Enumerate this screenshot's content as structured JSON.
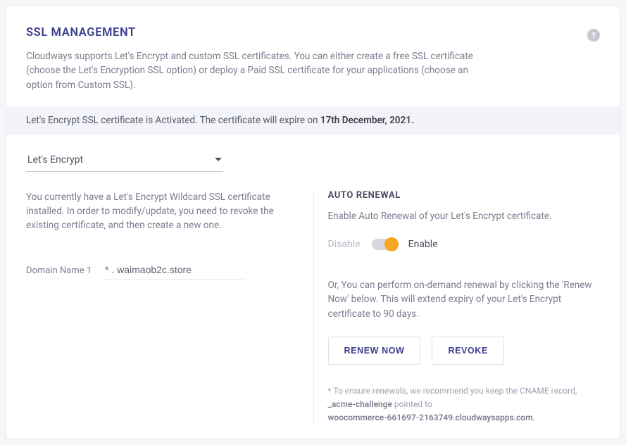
{
  "header": {
    "title": "SSL MANAGEMENT",
    "description": "Cloudways supports Let's Encrypt and custom SSL certificates. You can either create a free SSL certificate (choose the Let's Encryption SSL option) or deploy a Paid SSL certificate for your applications (choose an option from Custom SSL).",
    "help_glyph": "?"
  },
  "status": {
    "prefix": "Let's Encrypt SSL certificate is Activated. The certificate will expire on ",
    "expiry": "17th December, 2021."
  },
  "dropdown": {
    "selected": "Let's Encrypt"
  },
  "left": {
    "info_text": "You currently have a Let's Encrypt Wildcard SSL certificate installed. In order to modify/update, you need to revoke the existing certificate, and then create a new one.",
    "domain_label": "Domain Name 1",
    "domain_value": "* . waimaob2c.store"
  },
  "right": {
    "section_title": "AUTO RENEWAL",
    "enable_text": "Enable Auto Renewal of your Let's Encrypt certificate.",
    "disable_label": "Disable",
    "enable_label": "Enable",
    "or_text": "Or, You can perform on-demand renewal by clicking the 'Renew Now' below. This will extend expiry of your Let's Encrypt certificate to 90 days.",
    "renew_btn": "RENEW NOW",
    "revoke_btn": "REVOKE",
    "footnote_prefix": "* To ensure renewals, we recommend you keep the CNAME record, ",
    "footnote_bold1": "_acme-challenge",
    "footnote_mid": " pointed to ",
    "footnote_bold2": "woocommerce-661697-2163749.cloudwaysapps.com."
  }
}
